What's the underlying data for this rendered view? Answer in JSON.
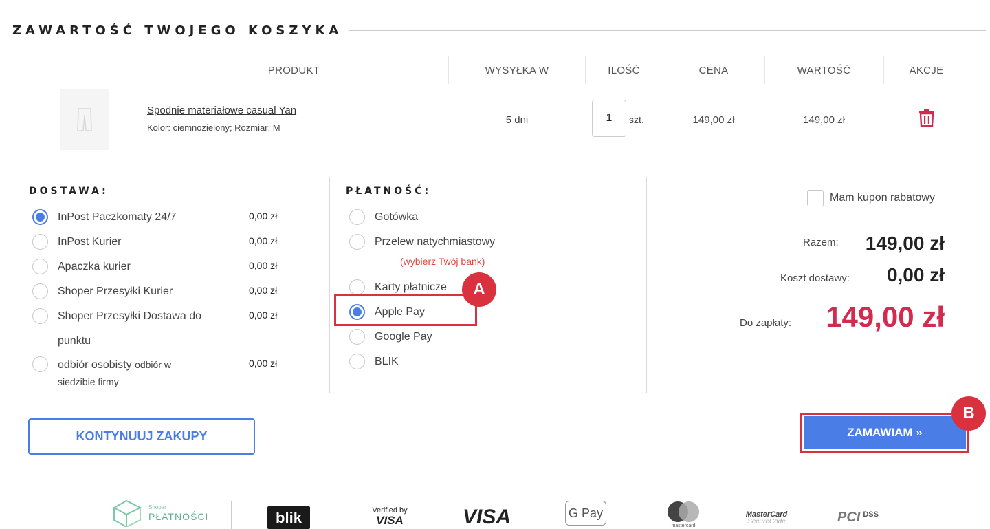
{
  "page_title": "ZAWARTOŚĆ TWOJEGO KOSZYKA",
  "table": {
    "headers": [
      "PRODUKT",
      "WYSYŁKA W",
      "ILOŚĆ",
      "CENA",
      "WARTOŚĆ",
      "AKCJE"
    ],
    "items": [
      {
        "name": "Spodnie materiałowe casual Yan",
        "attributes": "Kolor: ciemnozielony; Rozmiar: M",
        "shipping": "5 dni",
        "quantity": "1",
        "unit": "szt.",
        "price": "149,00 zł",
        "value": "149,00 zł"
      }
    ]
  },
  "delivery": {
    "title": "DOSTAWA:",
    "options": [
      {
        "label": "InPost Paczkomaty 24/7",
        "price": "0,00 zł",
        "checked": true
      },
      {
        "label": "InPost Kurier",
        "price": "0,00 zł",
        "checked": false
      },
      {
        "label": "Apaczka kurier",
        "price": "0,00 zł",
        "checked": false
      },
      {
        "label": "Shoper Przesyłki Kurier",
        "price": "0,00 zł",
        "checked": false
      },
      {
        "label_line1": "Shoper Przesyłki Dostawa do",
        "label_line2": "punktu",
        "price": "0,00 zł",
        "checked": false
      },
      {
        "label_main": "odbiór osobisty",
        "label_note": "odbiór w",
        "label_line2": "siedzibie firmy",
        "price": "0,00 zł",
        "checked": false
      }
    ]
  },
  "payment": {
    "title": "PŁATNOŚĆ:",
    "options": [
      {
        "label": "Gotówka",
        "checked": false
      },
      {
        "label": "Przelew natychmiastowy",
        "checked": false
      },
      {
        "label": "Karty płatnicze",
        "checked": false
      },
      {
        "label": "Apple Pay",
        "checked": true
      },
      {
        "label": "Google Pay",
        "checked": false
      },
      {
        "label": "BLIK",
        "checked": false
      }
    ],
    "bank_link": "(wybierz Twój bank)"
  },
  "summary": {
    "coupon_label": "Mam kupon rabatowy",
    "subtotal_label": "Razem:",
    "subtotal_value": "149,00 zł",
    "shipping_label": "Koszt dostawy:",
    "shipping_value": "0,00 zł",
    "total_label": "Do zapłaty:",
    "total_value": "149,00 zł"
  },
  "buttons": {
    "continue": "KONTYNUUJ ZAKUPY",
    "order": "ZAMAWIAM »"
  },
  "annotations": {
    "a": "A",
    "b": "B"
  },
  "footer_logos": {
    "shoper_small": "Shoper",
    "shoper_big": "PŁATNOŚCI",
    "blik": "blik",
    "verified_line1": "Verified by",
    "verified_line2": "VISA",
    "visa": "VISA",
    "gpay": "G Pay",
    "mastercard": "mastercard",
    "mc_secure_line1": "MasterCard",
    "mc_secure_line2": "SecureCode",
    "pci": "PCI",
    "dss": "DSS"
  },
  "colors": {
    "accent": "#4a7de5",
    "total": "#d32a4e",
    "highlight": "#d9313e",
    "link": "#e3473c"
  }
}
